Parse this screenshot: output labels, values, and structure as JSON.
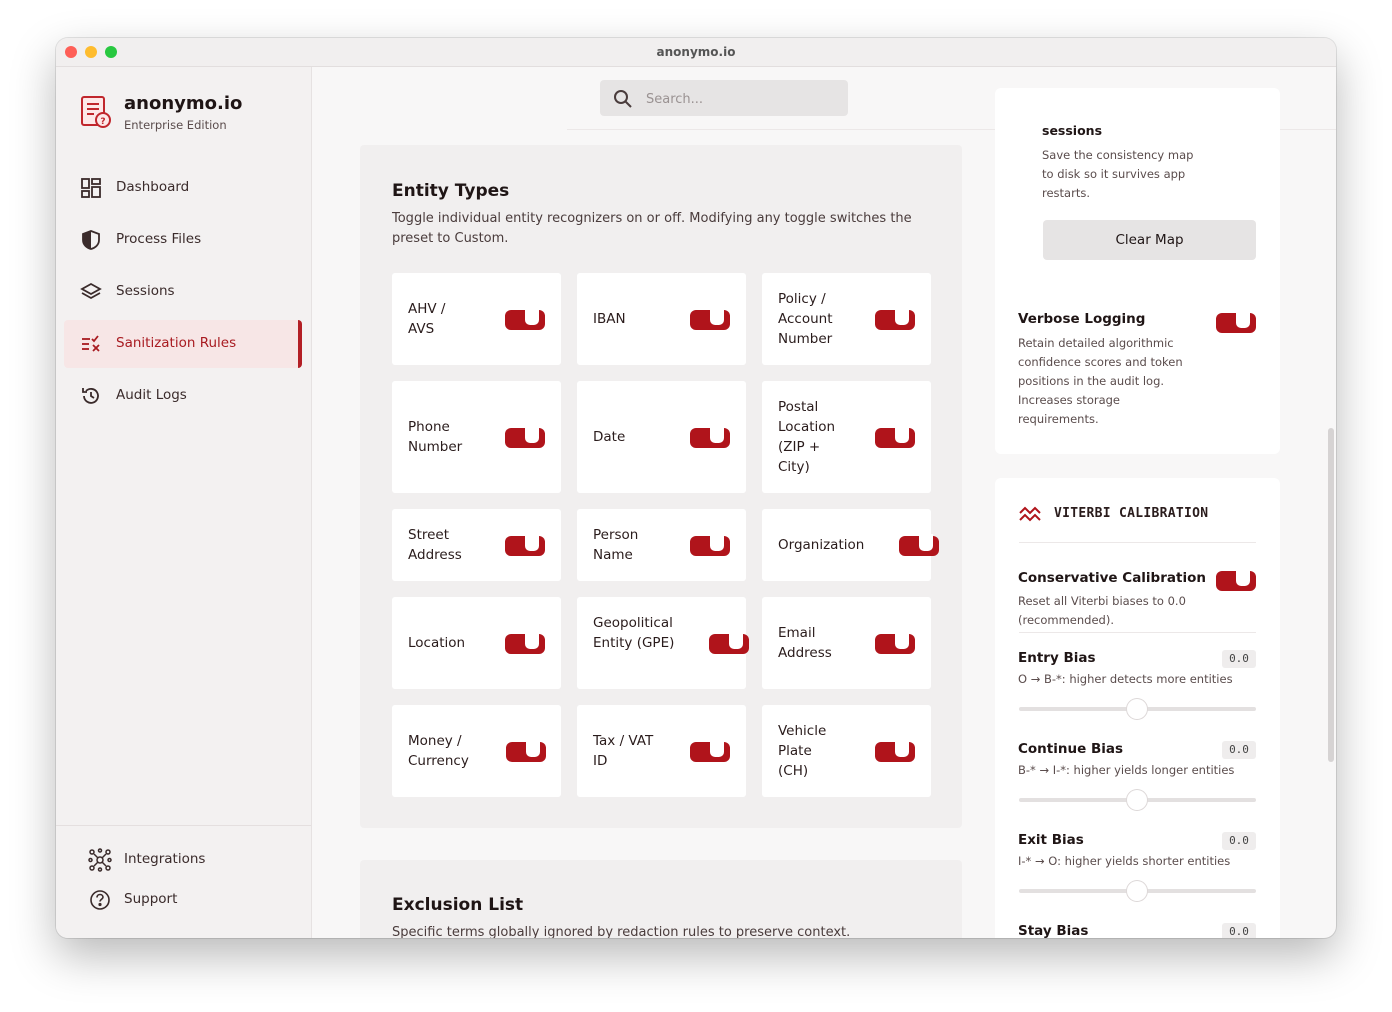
{
  "window": {
    "title": "anonymo.io"
  },
  "brand": {
    "name": "anonymo.io",
    "edition": "Enterprise Edition"
  },
  "nav": {
    "items": [
      {
        "label": "Dashboard",
        "icon": "dashboard-icon"
      },
      {
        "label": "Process Files",
        "icon": "shield-icon"
      },
      {
        "label": "Sessions",
        "icon": "layers-icon"
      },
      {
        "label": "Sanitization Rules",
        "icon": "rules-icon",
        "active": true
      },
      {
        "label": "Audit Logs",
        "icon": "history-icon"
      }
    ],
    "bottom": [
      {
        "label": "Integrations",
        "icon": "integrations-icon"
      },
      {
        "label": "Support",
        "icon": "help-icon"
      }
    ]
  },
  "search": {
    "placeholder": "Search..."
  },
  "entity_types": {
    "title": "Entity Types",
    "description": "Toggle individual entity recognizers on or off. Modifying any toggle switches the preset to Custom.",
    "items": [
      {
        "label": "AHV / AVS",
        "enabled": true
      },
      {
        "label": "IBAN",
        "enabled": true
      },
      {
        "label": "Policy / Account Number",
        "enabled": true
      },
      {
        "label": "Phone Number",
        "enabled": true
      },
      {
        "label": "Date",
        "enabled": true
      },
      {
        "label": "Postal Location (ZIP + City)",
        "enabled": true
      },
      {
        "label": "Street Address",
        "enabled": true
      },
      {
        "label": "Person Name",
        "enabled": true
      },
      {
        "label": "Organization",
        "enabled": true
      },
      {
        "label": "Location",
        "enabled": true
      },
      {
        "label": "Geopolitical Entity (GPE)",
        "enabled": true
      },
      {
        "label": "Email Address",
        "enabled": true
      },
      {
        "label": "Money / Currency",
        "enabled": true
      },
      {
        "label": "Tax / VAT ID",
        "enabled": true
      },
      {
        "label": "Vehicle Plate (CH)",
        "enabled": true
      }
    ]
  },
  "exclusion": {
    "title": "Exclusion List",
    "description": "Specific terms globally ignored by redaction rules to preserve context."
  },
  "sessions_card": {
    "heading_partial": "sessions",
    "description": "Save the consistency map to disk so it survives app restarts.",
    "clear_button": "Clear Map"
  },
  "verbose_logging": {
    "title": "Verbose Logging",
    "description": "Retain detailed algorithmic confidence scores and token positions in the audit log. Increases storage requirements.",
    "enabled": true
  },
  "viterbi": {
    "title": "VITERBI CALIBRATION",
    "conservative": {
      "title": "Conservative Calibration",
      "description": "Reset all Viterbi biases to 0.0 (recommended).",
      "enabled": true
    },
    "biases": [
      {
        "name": "Entry Bias",
        "value": "0.0",
        "hint": "O → B-*: higher detects more entities"
      },
      {
        "name": "Continue Bias",
        "value": "0.0",
        "hint": "B-* → I-*: higher yields longer entities"
      },
      {
        "name": "Exit Bias",
        "value": "0.0",
        "hint": "I-* → O: higher yields shorter entities"
      },
      {
        "name": "Stay Bias",
        "value": "0.0",
        "hint": ""
      }
    ]
  },
  "colors": {
    "accent": "#b0141b",
    "active_bg": "#f7e6e6"
  }
}
